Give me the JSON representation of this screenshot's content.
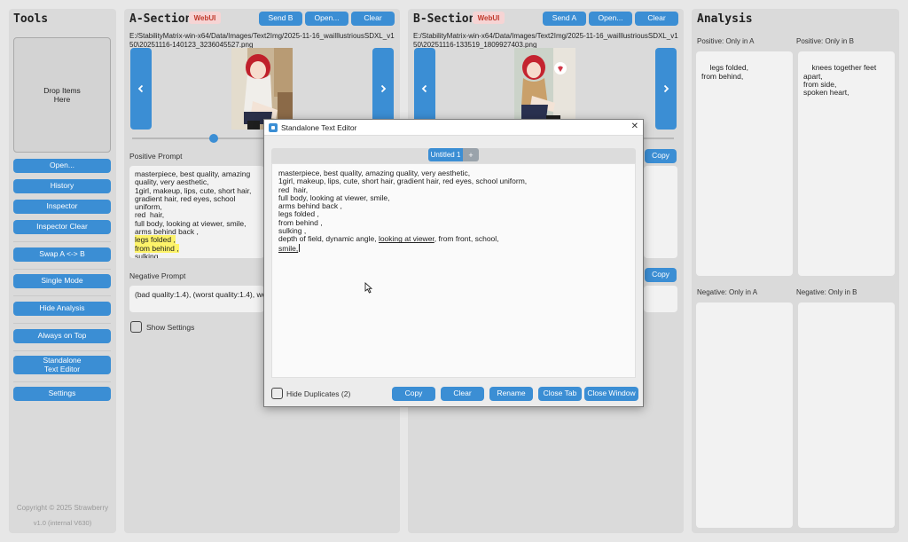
{
  "tools": {
    "title": "Tools",
    "drop_label": "Drop Items\nHere",
    "buttons": [
      "Open...",
      "History",
      "Inspector",
      "Inspector Clear",
      "Swap A <-> B",
      "Single Mode",
      "Hide Analysis",
      "Always on Top",
      "Standalone\nText Editor",
      "Settings"
    ],
    "copyright": "Copyright © 2025 Strawberry",
    "version": "v1.0 (internal V630)"
  },
  "a_section": {
    "title": "A-Section",
    "badge": "WebUI",
    "buttons": {
      "send": "Send B",
      "open": "Open...",
      "clear": "Clear"
    },
    "path": "E:/StabilityMatrix-win-x64/Data/Images/Text2Img/2025-11-16_waiIllustriousSDXL_v150\\20251116-140123_3236045527.png",
    "slider_value": 0.62,
    "positive_label": "Positive Prompt",
    "positive_lines": [
      [
        {
          "t": "masterpiece, best quality, amazing quality, very aesthetic,"
        }
      ],
      [
        {
          "t": "1girl, makeup, lips, cute, short hair, gradient hair, red eyes, school uniform,"
        }
      ],
      [
        {
          "t": "red  hair,"
        }
      ],
      [
        {
          "t": "full body, looking at viewer, smile,"
        }
      ],
      [
        {
          "t": "arms behind back ,"
        }
      ],
      [
        {
          "t": "legs folded ,",
          "hl": true
        }
      ],
      [
        {
          "t": "from behind ,",
          "hl": true
        }
      ],
      [
        {
          "t": "sulking ,"
        }
      ],
      [
        {
          "t": "depth of field, dynamic angle, "
        },
        {
          "t": "looking at viewer",
          "ul": true
        },
        {
          "t": ", from front, school,"
        }
      ],
      [
        {
          "t": "smile,",
          "ul": true
        }
      ]
    ],
    "negative_label": "Negative Prompt",
    "negative_text": "(bad quality:1.4), (worst quality:1.4), worst quality, low quality, bad anatomy",
    "show_settings": "Show Settings"
  },
  "b_section": {
    "title": "B-Section",
    "badge": "WebUI",
    "buttons": {
      "send": "Send A",
      "open": "Open...",
      "clear": "Clear",
      "copy_pos": "Copy",
      "copy_neg": "Copy"
    },
    "path": "E:/StabilityMatrix-win-x64/Data/Images/Text2Img/2025-11-16_waiIllustriousSDXL_v150\\20251116-133519_1809927403.png"
  },
  "analysis": {
    "title": "Analysis",
    "pos_a_label": "Positive: Only in A",
    "pos_b_label": "Positive: Only in B",
    "pos_a_text": "legs folded,\nfrom behind,",
    "pos_b_text": "knees together feet apart,\nfrom side,\nspoken heart,",
    "neg_a_label": "Negative: Only in A",
    "neg_b_label": "Negative: Only in B"
  },
  "editor": {
    "title": "Standalone Text Editor",
    "tab": "Untitled 1",
    "add_tab": "+",
    "lines": [
      [
        {
          "t": "masterpiece, best quality, amazing quality, very aesthetic,"
        }
      ],
      [
        {
          "t": "1girl, makeup, lips, cute, short hair, gradient hair, red eyes, school uniform,"
        }
      ],
      [
        {
          "t": "red  hair,"
        }
      ],
      [
        {
          "t": "full body, looking at viewer, smile,"
        }
      ],
      [
        {
          "t": "arms behind back ,"
        }
      ],
      [
        {
          "t": "legs folded ,"
        }
      ],
      [
        {
          "t": "from behind ,"
        }
      ],
      [
        {
          "t": "sulking ,"
        }
      ],
      [
        {
          "t": "depth of field, dynamic angle, "
        },
        {
          "t": "looking at viewer",
          "ul": true
        },
        {
          "t": ", from front, school,"
        }
      ],
      [
        {
          "t": "smile,",
          "ul": true
        }
      ]
    ],
    "hide_duplicates": "Hide Duplicates (2)",
    "buttons": {
      "copy": "Copy",
      "clear": "Clear",
      "rename": "Rename",
      "close_tab": "Close Tab",
      "close_window": "Close Window"
    },
    "close_glyph": "✕"
  },
  "colors": {
    "accent": "#3b8ed4",
    "badge_bg": "#f6d4d4",
    "badge_text": "#c0392b",
    "highlight": "#fdf36a"
  }
}
